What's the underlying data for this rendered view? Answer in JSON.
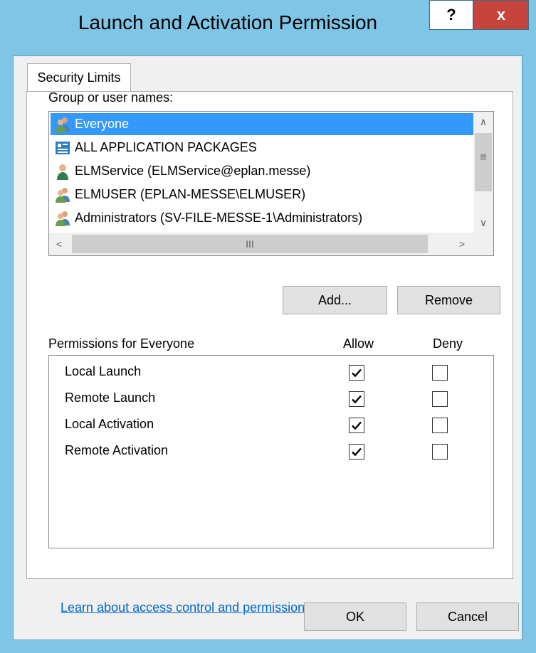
{
  "window": {
    "title": "Launch and Activation Permission",
    "help_label": "?",
    "close_label": "x",
    "frame_color": "#7ec5e6",
    "close_color": "#c7443d"
  },
  "tab": {
    "label": "Security Limits"
  },
  "users": {
    "label": "Group or user names:",
    "items": [
      {
        "name": "Everyone",
        "icon": "user-group-icon",
        "selected": true
      },
      {
        "name": "ALL APPLICATION PACKAGES",
        "icon": "app-packages-icon",
        "selected": false
      },
      {
        "name": "ELMService (ELMService@eplan.messe)",
        "icon": "user-icon",
        "selected": false
      },
      {
        "name": "ELMUSER (EPLAN-MESSE\\ELMUSER)",
        "icon": "user-group-icon",
        "selected": false
      },
      {
        "name": "Administrators (SV-FILE-MESSE-1\\Administrators)",
        "icon": "user-group-icon",
        "selected": false
      }
    ],
    "scroll_up": "∧",
    "scroll_down": "∨",
    "scroll_grip_v": "≡",
    "scroll_left": "<",
    "scroll_right": ">",
    "scroll_grip_h": "III"
  },
  "buttons": {
    "add": "Add...",
    "remove": "Remove",
    "ok": "OK",
    "cancel": "Cancel"
  },
  "permissions": {
    "label": "Permissions for Everyone",
    "allow_header": "Allow",
    "deny_header": "Deny",
    "rows": [
      {
        "name": "Local Launch",
        "allow": true,
        "deny": false
      },
      {
        "name": "Remote Launch",
        "allow": true,
        "deny": false
      },
      {
        "name": "Local Activation",
        "allow": true,
        "deny": false
      },
      {
        "name": "Remote Activation",
        "allow": true,
        "deny": false
      }
    ]
  },
  "link": {
    "text": "Learn about access control and permissions"
  },
  "colors": {
    "selection": "#3399ff",
    "link": "#0066cc"
  }
}
